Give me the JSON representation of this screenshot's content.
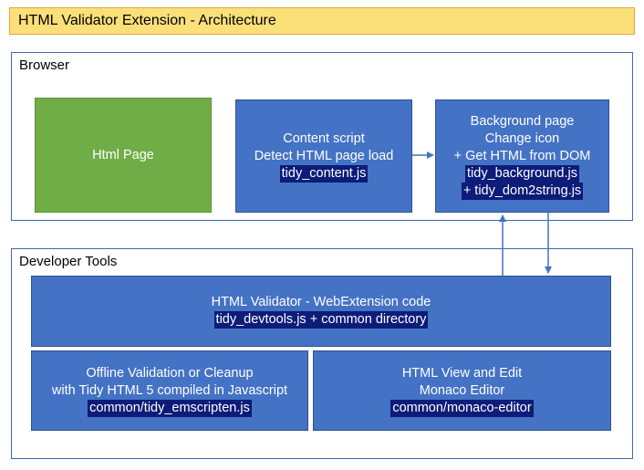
{
  "title": "HTML Validator Extension - Architecture",
  "browser": {
    "label": "Browser",
    "html_page": "Html Page",
    "content_script": {
      "line1": "Content script",
      "line2": "Detect HTML page load",
      "file": "tidy_content.js"
    },
    "background_page": {
      "line1": "Background page",
      "line2": "Change icon",
      "line3": "+ Get HTML from DOM",
      "file1": "tidy_background.js",
      "file2": "+ tidy_dom2string.js"
    }
  },
  "devtools": {
    "label": "Developer Tools",
    "validator": {
      "line1": "HTML Validator - WebExtension code",
      "file": "tidy_devtools.js + common directory"
    },
    "offline": {
      "line1": "Offline Validation or Cleanup",
      "line2": "with Tidy HTML 5 compiled in Javascript",
      "file": "common/tidy_emscripten.js"
    },
    "editor": {
      "line1": "HTML View and Edit",
      "line2": "Monaco Editor",
      "file": "common/monaco-editor"
    }
  },
  "colors": {
    "box_blue": "#4472c4",
    "box_green": "#70ad47",
    "code_bg": "#0c1c78",
    "title_bg": "#fbe07a",
    "group_border": "#3b6aa8"
  }
}
